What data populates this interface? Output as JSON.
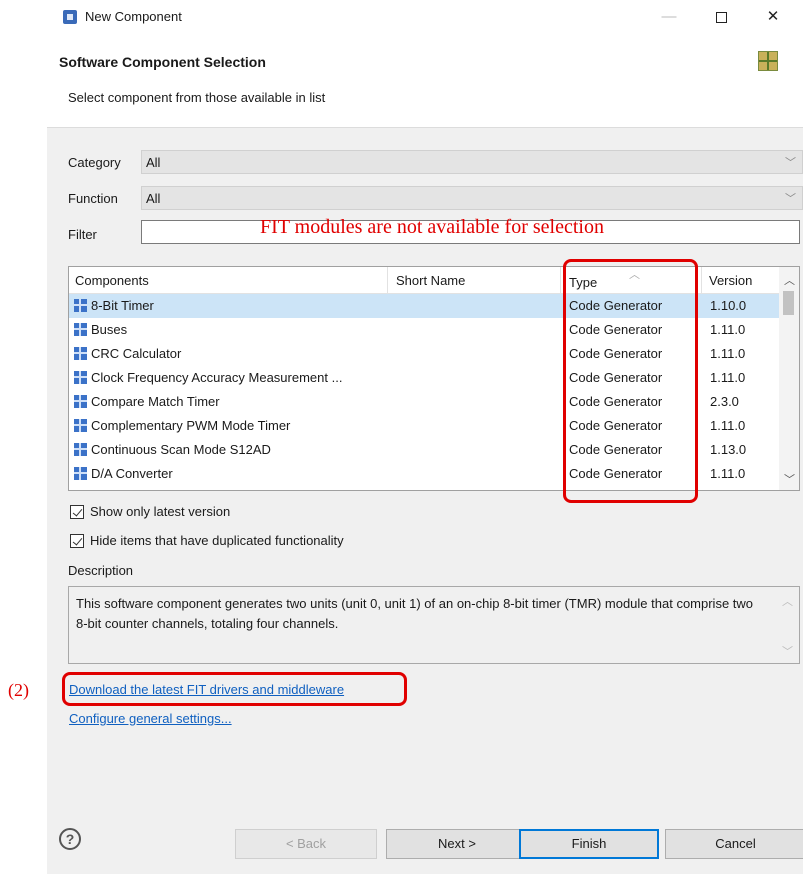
{
  "window": {
    "title": "New Component"
  },
  "header": {
    "title": "Software Component Selection",
    "subtitle": "Select component from those available in list"
  },
  "form": {
    "category": {
      "label": "Category",
      "value": "All"
    },
    "function": {
      "label": "Function",
      "value": "All"
    },
    "filter": {
      "label": "Filter",
      "value": ""
    }
  },
  "annotations": {
    "fit_note": "FIT modules are not available for selection",
    "marker_2": "(2)"
  },
  "table": {
    "headers": [
      "Components",
      "Short Name",
      "Type",
      "Version"
    ],
    "rows": [
      {
        "name": "8-Bit Timer",
        "short": "",
        "type": "Code Generator",
        "version": "1.10.0"
      },
      {
        "name": "Buses",
        "short": "",
        "type": "Code Generator",
        "version": "1.11.0"
      },
      {
        "name": "CRC Calculator",
        "short": "",
        "type": "Code Generator",
        "version": "1.11.0"
      },
      {
        "name": "Clock Frequency Accuracy Measurement ...",
        "short": "",
        "type": "Code Generator",
        "version": "1.11.0"
      },
      {
        "name": "Compare Match Timer",
        "short": "",
        "type": "Code Generator",
        "version": "2.3.0"
      },
      {
        "name": "Complementary PWM Mode Timer",
        "short": "",
        "type": "Code Generator",
        "version": "1.11.0"
      },
      {
        "name": "Continuous Scan Mode S12AD",
        "short": "",
        "type": "Code Generator",
        "version": "1.13.0"
      },
      {
        "name": "D/A Converter",
        "short": "",
        "type": "Code Generator",
        "version": "1.11.0"
      }
    ]
  },
  "options": {
    "latest_only": {
      "label": "Show only latest version",
      "checked": true
    },
    "hide_dup": {
      "label": "Hide items that have duplicated functionality",
      "checked": true
    }
  },
  "description": {
    "label": "Description",
    "text": "This software component generates two units (unit 0, unit 1) of an on-chip 8-bit timer (TMR) module that comprise two 8-bit counter channels, totaling four channels."
  },
  "links": {
    "download": "Download the latest FIT drivers and middleware",
    "configure": "Configure general settings..."
  },
  "buttons": {
    "help": "?",
    "back": "< Back",
    "next": "Next >",
    "finish": "Finish",
    "cancel": "Cancel"
  }
}
